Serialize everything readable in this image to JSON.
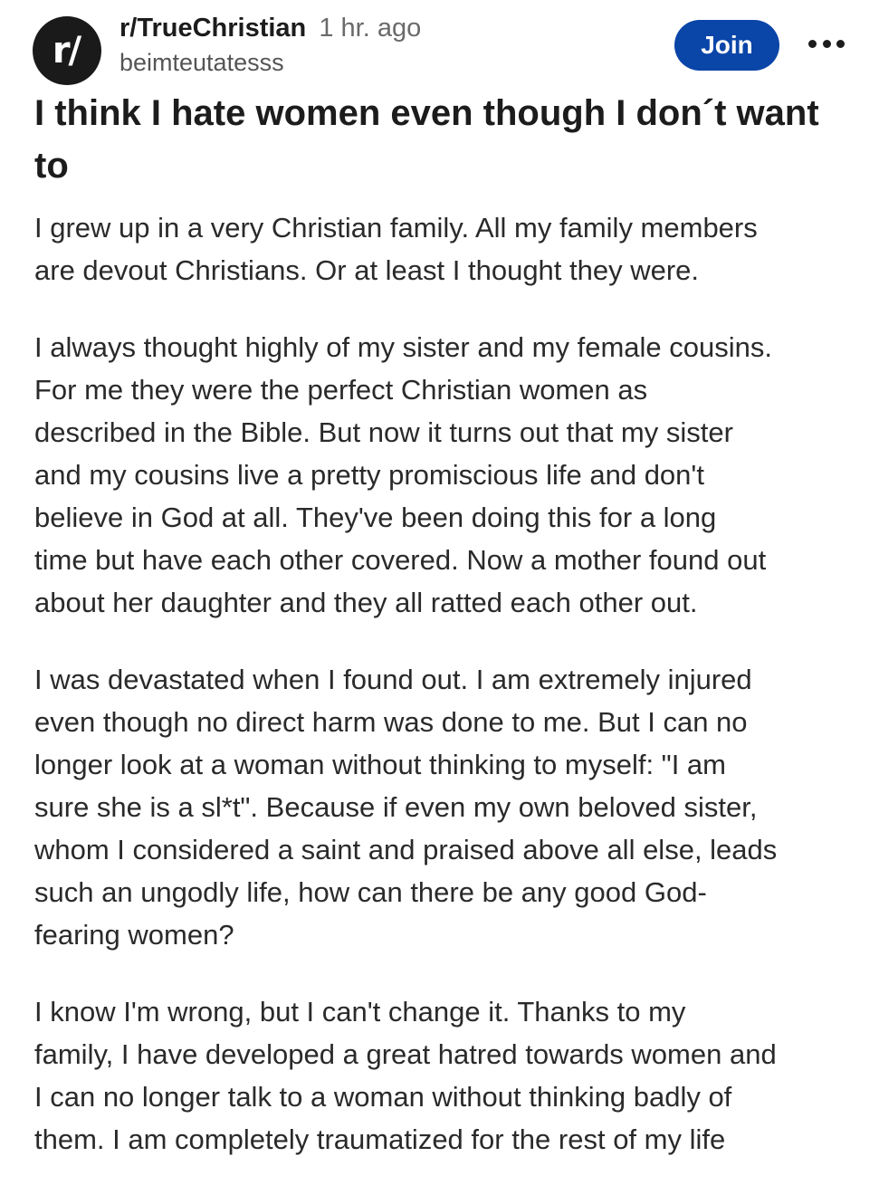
{
  "post": {
    "subreddit_icon_text": "r/",
    "subreddit": "r/TrueChristian",
    "time": "1 hr. ago",
    "username": "beimteutatesss",
    "join_label": "Join",
    "more_icon": "more-horizontal-icon",
    "title": "I think I hate women even though I don´t want to",
    "paragraphs": [
      "I grew up in a very Christian family. All my family members\nare devout Christians. Or at least I thought they were.",
      "I always thought highly of my sister and my female cousins.\nFor me they were the perfect Christian women as\ndescribed in the Bible. But now it turns out that my sister\nand my cousins live a pretty promiscious life and don't\nbelieve in God at all. They've been doing this for a long\ntime but have each other covered. Now a mother found out\nabout her daughter and they all ratted each other out.",
      "I was devastated when I found out. I am extremely injured\neven though no direct harm was done to me. But I can no\nlonger look at a woman without thinking to myself: \"I am\nsure she is a sl*t\". Because if even my own beloved sister,\nwhom I considered a saint and praised above all else, leads\nsuch an ungodly life, how can there be any good God-\nfearing women?",
      "I know I'm wrong, but I can't change it. Thanks to my\nfamily, I have developed a great hatred towards women and\nI can no longer talk to a woman without thinking badly of\nthem. I am completely traumatized for the rest of my life"
    ]
  },
  "colors": {
    "join_button": "#0a45a8",
    "avatar_bg": "#1a1a1a",
    "text": "#1c1c1c",
    "muted": "#6a6a6a"
  }
}
